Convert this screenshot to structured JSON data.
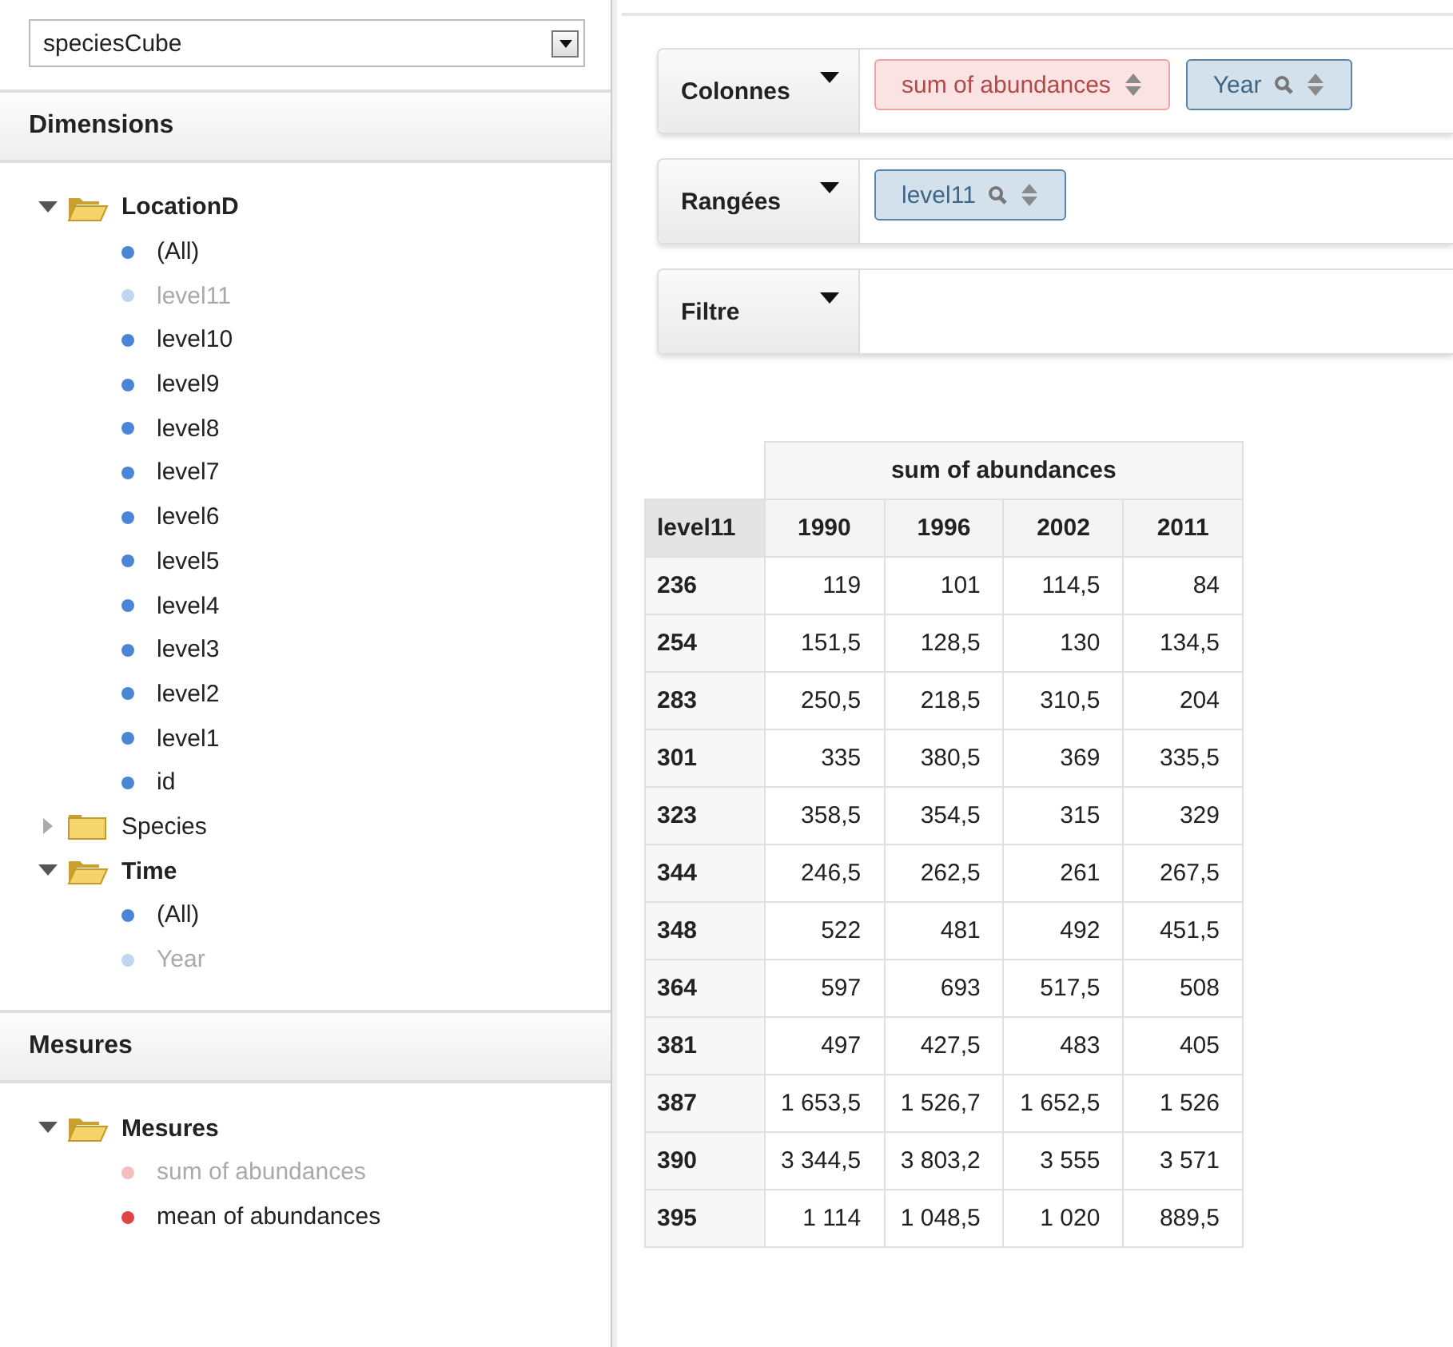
{
  "cube_selector": {
    "value": "speciesCube"
  },
  "dimensions": {
    "title": "Dimensions",
    "tree": [
      {
        "label": "LocationD",
        "expanded": true,
        "children": [
          {
            "label": "(All)",
            "kind": "level",
            "disabled": false
          },
          {
            "label": "level11",
            "kind": "level",
            "disabled": true
          },
          {
            "label": "level10",
            "kind": "level",
            "disabled": false
          },
          {
            "label": "level9",
            "kind": "level",
            "disabled": false
          },
          {
            "label": "level8",
            "kind": "level",
            "disabled": false
          },
          {
            "label": "level7",
            "kind": "level",
            "disabled": false
          },
          {
            "label": "level6",
            "kind": "level",
            "disabled": false
          },
          {
            "label": "level5",
            "kind": "level",
            "disabled": false
          },
          {
            "label": "level4",
            "kind": "level",
            "disabled": false
          },
          {
            "label": "level3",
            "kind": "level",
            "disabled": false
          },
          {
            "label": "level2",
            "kind": "level",
            "disabled": false
          },
          {
            "label": "level1",
            "kind": "level",
            "disabled": false
          },
          {
            "label": "id",
            "kind": "level",
            "disabled": false
          }
        ]
      },
      {
        "label": "Species",
        "expanded": false
      },
      {
        "label": "Time",
        "expanded": true,
        "children": [
          {
            "label": "(All)",
            "kind": "level",
            "disabled": false
          },
          {
            "label": "Year",
            "kind": "level",
            "disabled": true
          }
        ]
      }
    ]
  },
  "measures": {
    "title": "Mesures",
    "tree": [
      {
        "label": "Mesures",
        "expanded": true,
        "children": [
          {
            "label": "sum of abundances",
            "kind": "measure",
            "disabled": true
          },
          {
            "label": "mean of abundances",
            "kind": "measure",
            "disabled": false
          }
        ]
      }
    ]
  },
  "zones": [
    {
      "label": "Colonnes",
      "chips": [
        {
          "label": "sum of abundances",
          "kind": "measure"
        },
        {
          "label": "Year",
          "kind": "dimension"
        }
      ]
    },
    {
      "label": "Rangées",
      "chips": [
        {
          "label": "level11",
          "kind": "dimension"
        }
      ]
    },
    {
      "label": "Filtre"
    }
  ],
  "table": {
    "measure_header": "sum of abundances",
    "row_header": "level11",
    "columns": [
      "1990",
      "1996",
      "2002",
      "2011"
    ],
    "rows": [
      {
        "label": "236",
        "values": [
          "119",
          "101",
          "114,5",
          "84"
        ]
      },
      {
        "label": "254",
        "values": [
          "151,5",
          "128,5",
          "130",
          "134,5"
        ]
      },
      {
        "label": "283",
        "values": [
          "250,5",
          "218,5",
          "310,5",
          "204"
        ]
      },
      {
        "label": "301",
        "values": [
          "335",
          "380,5",
          "369",
          "335,5"
        ]
      },
      {
        "label": "323",
        "values": [
          "358,5",
          "354,5",
          "315",
          "329"
        ]
      },
      {
        "label": "344",
        "values": [
          "246,5",
          "262,5",
          "261",
          "267,5"
        ]
      },
      {
        "label": "348",
        "values": [
          "522",
          "481",
          "492",
          "451,5"
        ]
      },
      {
        "label": "364",
        "values": [
          "597",
          "693",
          "517,5",
          "508"
        ]
      },
      {
        "label": "381",
        "values": [
          "497",
          "427,5",
          "483",
          "405"
        ]
      },
      {
        "label": "387",
        "values": [
          "1 653,5",
          "1 526,7",
          "1 652,5",
          "1 526"
        ]
      },
      {
        "label": "390",
        "values": [
          "3 344,5",
          "3 803,2",
          "3 555",
          "3 571"
        ]
      },
      {
        "label": "395",
        "values": [
          "1 114",
          "1 048,5",
          "1 020",
          "889,5"
        ]
      }
    ]
  }
}
